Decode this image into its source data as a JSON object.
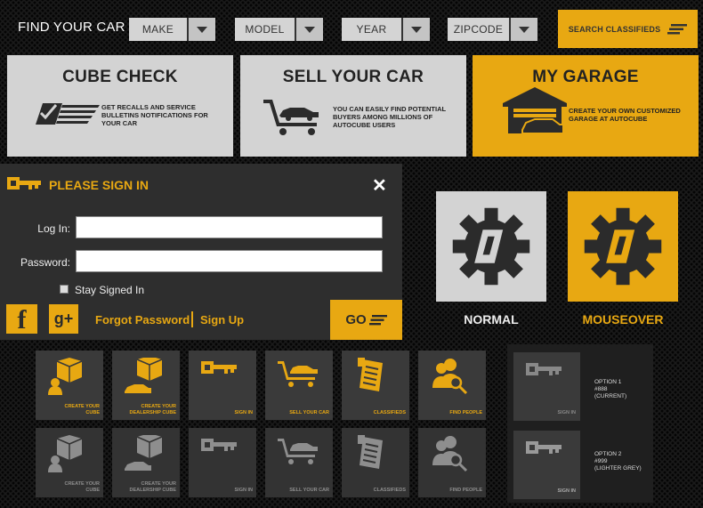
{
  "topbar": {
    "title": "FIND YOUR CAR",
    "dropdowns": [
      {
        "label": "MAKE"
      },
      {
        "label": "MODEL"
      },
      {
        "label": "YEAR"
      },
      {
        "label": "ZIPCODE"
      }
    ],
    "search_label": "SEARCH CLASSIFIEDS"
  },
  "features": [
    {
      "title": "CUBE CHECK",
      "desc": "GET RECALLS AND SERVICE BULLETINS NOTIFICATIONS FOR YOUR CAR",
      "icon": "checklist-icon",
      "active": false
    },
    {
      "title": "SELL YOUR CAR",
      "desc": "YOU CAN EASILY FIND POTENTIAL BUYERS AMONG MILLIONS OF AUTOCUBE USERS",
      "icon": "cart-car-icon",
      "active": false
    },
    {
      "title": "MY GARAGE",
      "desc": "CREATE YOUR OWN CUSTOMIZED GARAGE AT AUTOCUBE",
      "icon": "garage-icon",
      "active": true
    }
  ],
  "signin": {
    "title": "PLEASE SIGN IN",
    "login_label": "Log In:",
    "password_label": "Password:",
    "login_value": "",
    "password_value": "",
    "stay_label": "Stay Signed In",
    "forgot_label": "Forgot Password",
    "signup_label": "Sign Up",
    "go_label": "GO",
    "facebook_glyph": "f",
    "googleplus_glyph": "g+"
  },
  "states": [
    {
      "label": "NORMAL",
      "bg": "#d3d3d3"
    },
    {
      "label": "MOUSEOVER",
      "bg": "#e8a812"
    }
  ],
  "tiles_active": [
    {
      "label": "CREATE YOUR CUBE",
      "icon": "cube-user-icon"
    },
    {
      "label": "CREATE YOUR DEALERSHIP CUBE",
      "icon": "cube-car-icon"
    },
    {
      "label": "SIGN IN",
      "icon": "key-icon"
    },
    {
      "label": "SELL YOUR CAR",
      "icon": "cart-car-icon"
    },
    {
      "label": "CLASSIFIEDS",
      "icon": "classifieds-icon"
    },
    {
      "label": "FIND PEOPLE",
      "icon": "people-search-icon"
    }
  ],
  "tiles_inactive": [
    {
      "label": "CREATE YOUR CUBE",
      "icon": "cube-user-icon"
    },
    {
      "label": "CREATE YOUR DEALERSHIP CUBE",
      "icon": "cube-car-icon"
    },
    {
      "label": "SIGN IN",
      "icon": "key-icon"
    },
    {
      "label": "SELL YOUR CAR",
      "icon": "cart-car-icon"
    },
    {
      "label": "CLASSIFIEDS",
      "icon": "classifieds-icon"
    },
    {
      "label": "FIND PEOPLE",
      "icon": "people-search-icon"
    }
  ],
  "options": [
    {
      "tile_label": "SIGN IN",
      "line1": "OPTION 1",
      "line2": "#888",
      "line3": "(CURRENT)",
      "bg": "#888888"
    },
    {
      "tile_label": "SIGN IN",
      "line1": "OPTION 2",
      "line2": "#999",
      "line3": "(LIGHTER GREY)",
      "bg": "#999999"
    }
  ],
  "colors": {
    "accent": "#e8a812",
    "panel": "#2e2e2e",
    "light": "#d3d3d3"
  }
}
